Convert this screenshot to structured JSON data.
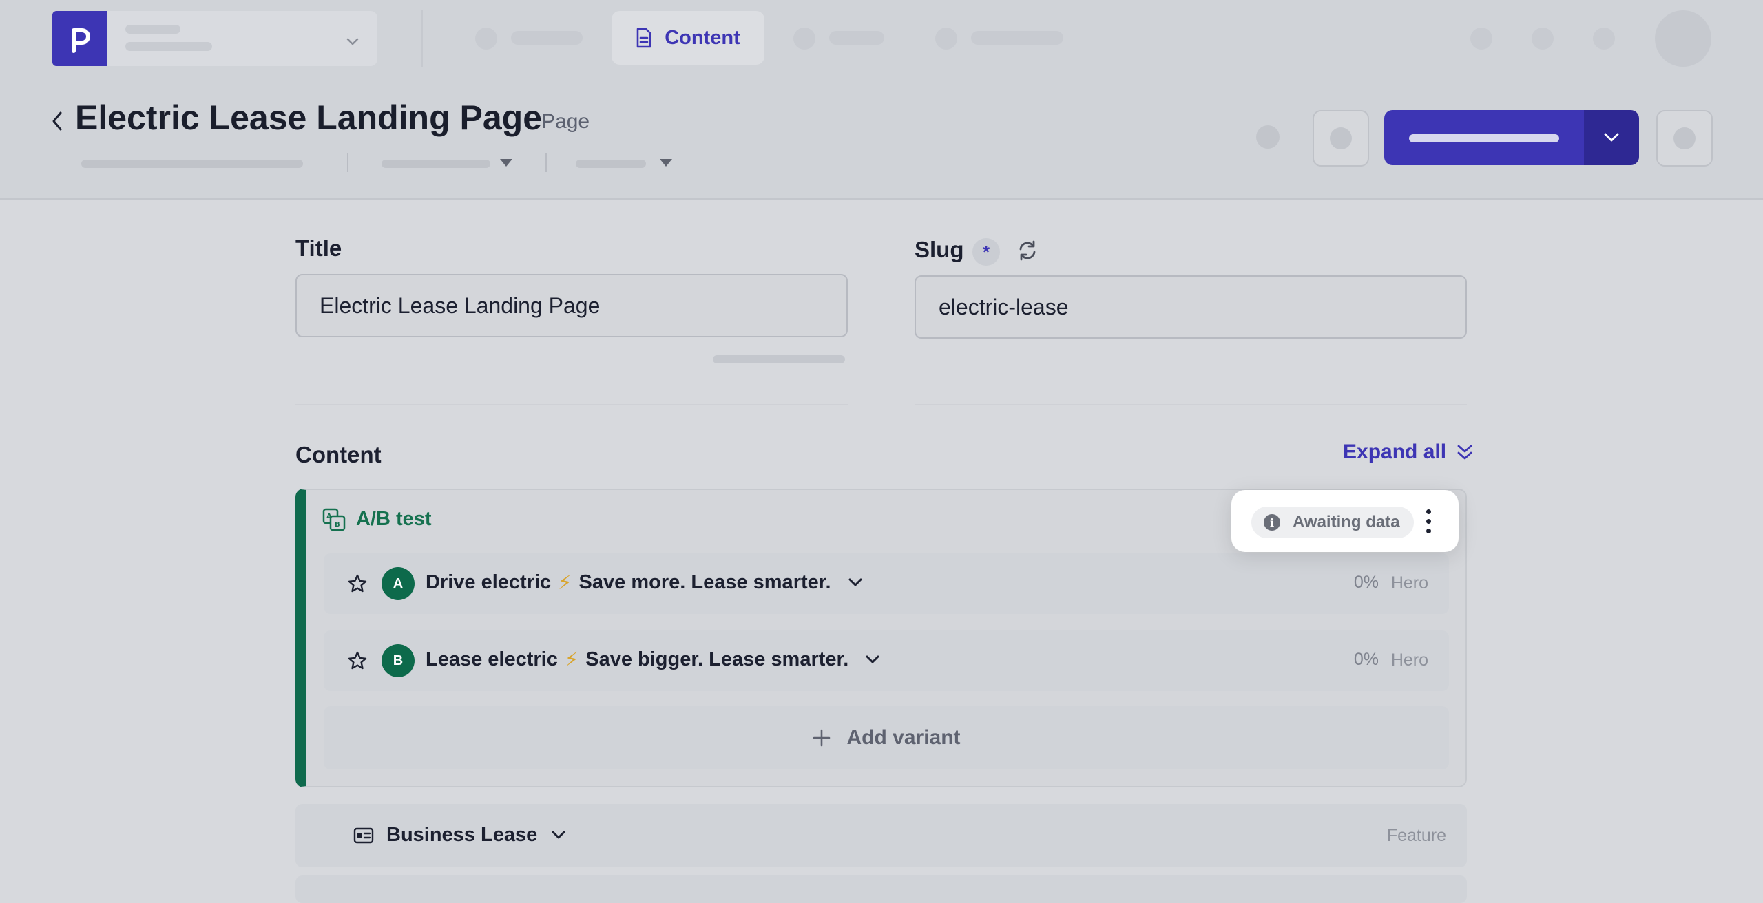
{
  "nav": {
    "active_tab": "Content",
    "icons": {
      "logo": "p-logo-icon",
      "org_chevron": "chevron-down-icon",
      "content_tab": "document-icon"
    }
  },
  "header": {
    "title": "Electric Lease Landing Page",
    "type_label": "Page",
    "icons": {
      "back": "chevron-left-icon",
      "publish_more": "chevron-down-icon"
    }
  },
  "form": {
    "title": {
      "label": "Title",
      "value": "Electric Lease Landing Page"
    },
    "slug": {
      "label": "Slug",
      "required_mark": "*",
      "value": "electric-lease",
      "icon": "refresh-icon"
    }
  },
  "content": {
    "heading": "Content",
    "expand_all": "Expand all",
    "ab_test": {
      "title": "A/B test",
      "status": "Awaiting data",
      "variants": [
        {
          "letter": "A",
          "title_before": "Drive electric",
          "bolt": "⚡",
          "title_after": "Save more. Lease smarter.",
          "percent": "0%",
          "type": "Hero"
        },
        {
          "letter": "B",
          "title_before": "Lease electric",
          "bolt": "⚡",
          "title_after": "Save bigger. Lease smarter.",
          "percent": "0%",
          "type": "Hero"
        }
      ],
      "add_variant": "Add variant"
    },
    "blocks": [
      {
        "title": "Business Lease",
        "type": "Feature",
        "icon": "id-card-icon"
      }
    ]
  },
  "colors": {
    "accent": "#3d35b4",
    "ab_green": "#0f6a4d",
    "background": "#d7d9dd"
  }
}
